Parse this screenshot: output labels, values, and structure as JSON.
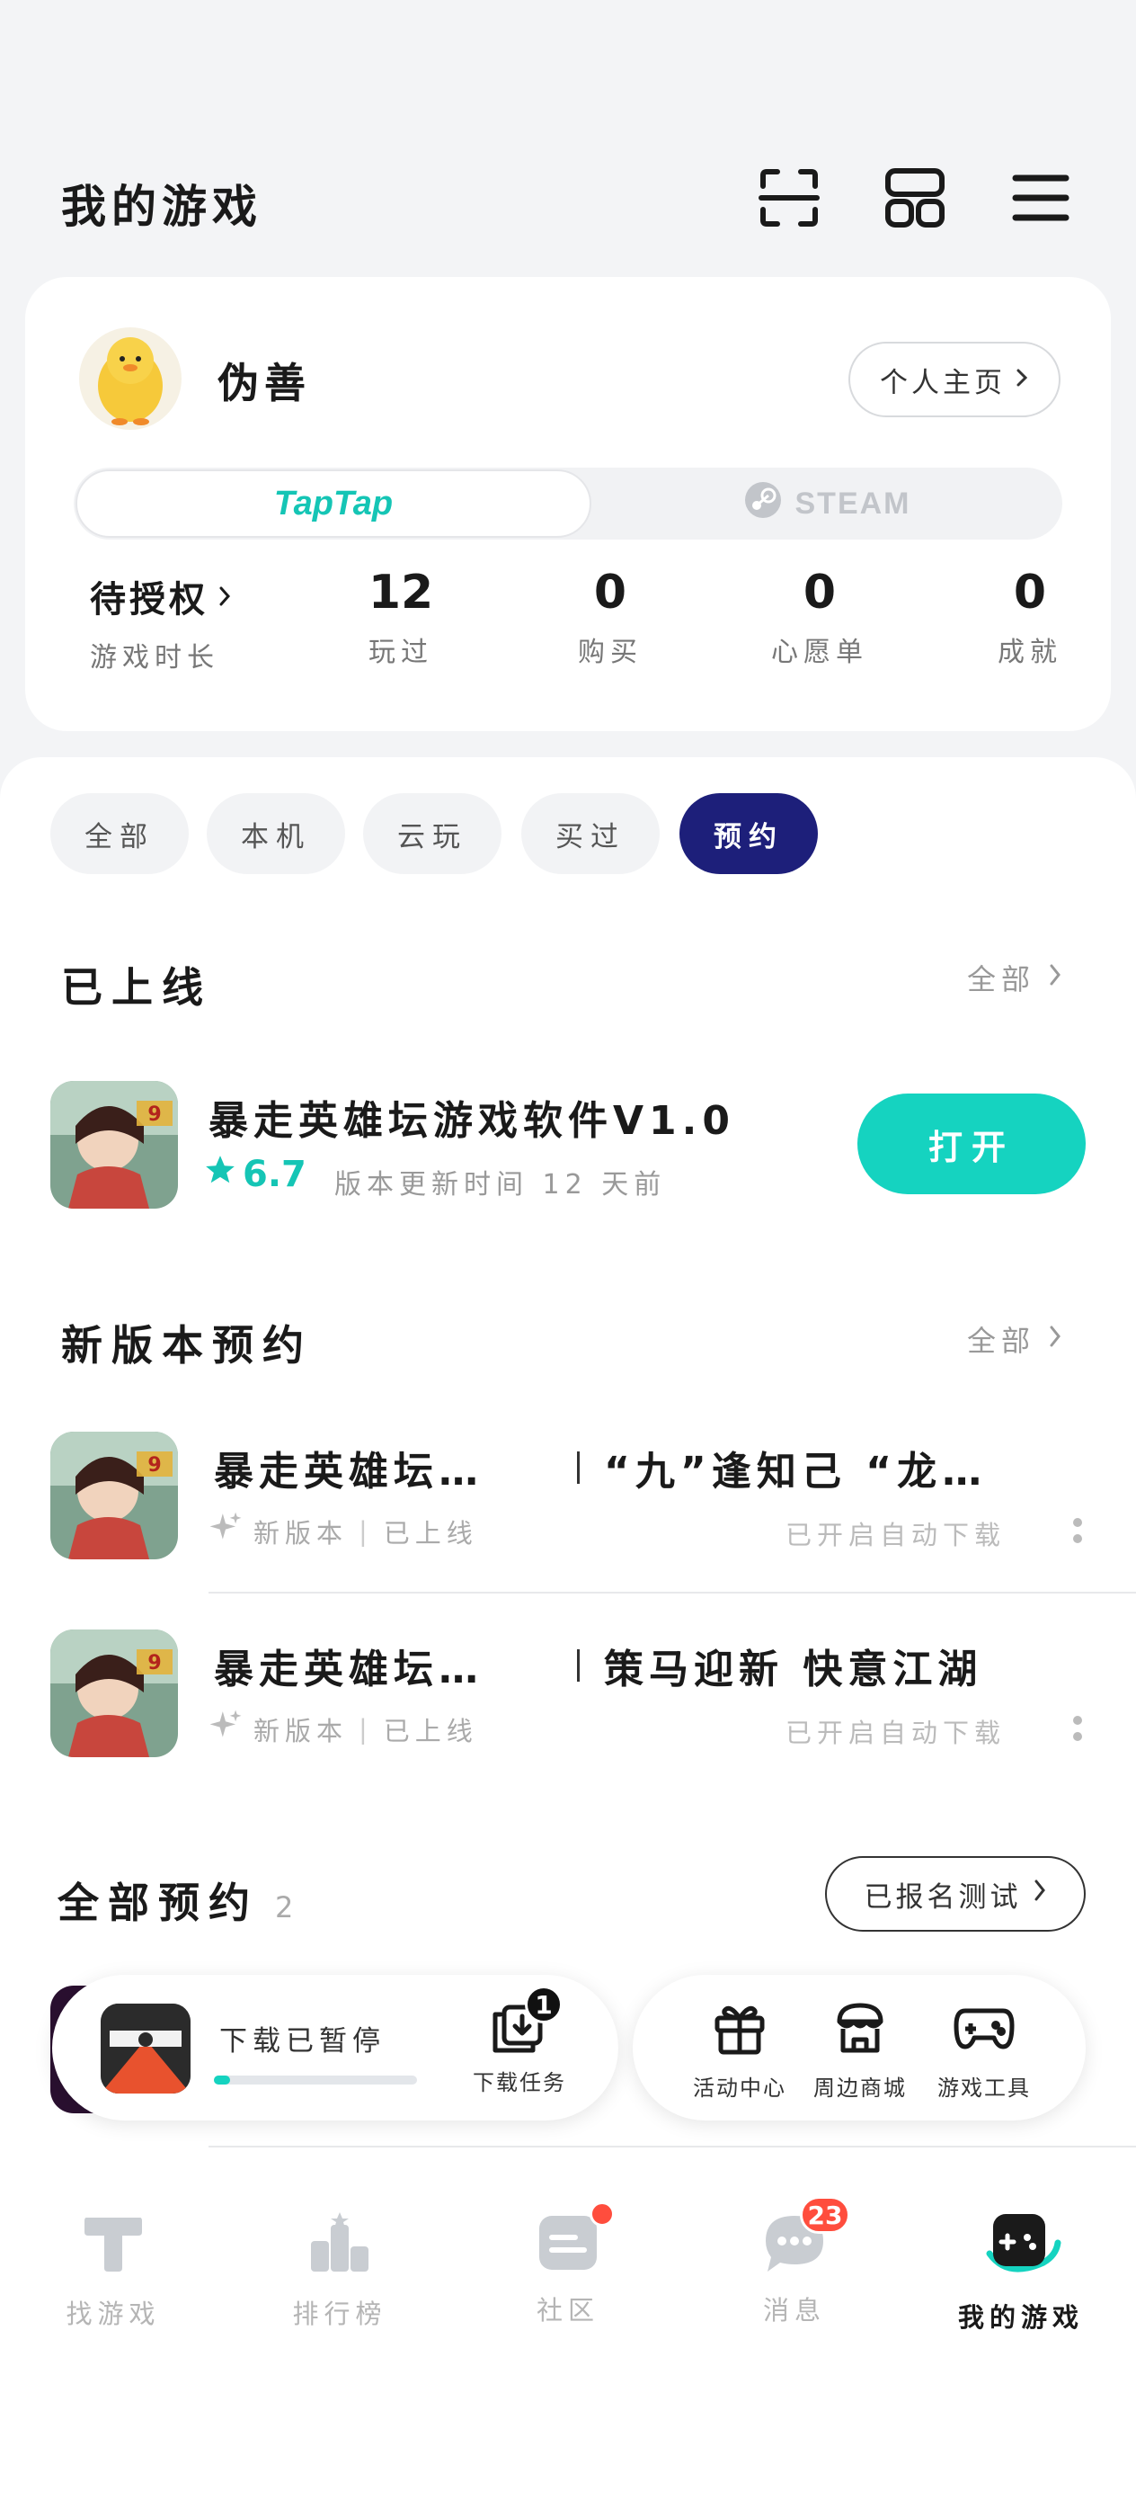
{
  "header": {
    "title": "我的游戏"
  },
  "profile": {
    "username": "伪善",
    "homepage_label": "个人主页",
    "platform_tabs": [
      {
        "label": "TapTap",
        "active": true
      },
      {
        "label": "STEAM",
        "active": false
      }
    ],
    "pending_label": "待授权",
    "pending_sub": "游戏时长",
    "stats": [
      {
        "value": "12",
        "label": "玩过"
      },
      {
        "value": "0",
        "label": "购买"
      },
      {
        "value": "0",
        "label": "心愿单"
      },
      {
        "value": "0",
        "label": "成就"
      }
    ]
  },
  "filters": [
    {
      "label": "全部",
      "active": false
    },
    {
      "label": "本机",
      "active": false
    },
    {
      "label": "云玩",
      "active": false
    },
    {
      "label": "买过",
      "active": false
    },
    {
      "label": "预约",
      "active": true
    }
  ],
  "online_section": {
    "title": "已上线",
    "more_label": "全部",
    "game": {
      "name": "暴走英雄坛游戏软件V1.0",
      "rating": "6.7",
      "update_note": "版本更新时间 12 天前",
      "action_label": "打开"
    }
  },
  "new_version_section": {
    "title": "新版本预约",
    "more_label": "全部",
    "rows": [
      {
        "game_name": "暴走英雄坛…",
        "headline": "“九”逢知己 “龙…",
        "tag": "新版本",
        "status": "已上线",
        "auto_note": "已开启自动下载"
      },
      {
        "game_name": "暴走英雄坛…",
        "headline": "策马迎新 快意江湖",
        "tag": "新版本",
        "status": "已上线",
        "auto_note": "已开启自动下载"
      }
    ]
  },
  "all_reservations": {
    "title": "全部预约",
    "count": "2",
    "signup_label": "已报名测试"
  },
  "download_panel": {
    "status": "下载已暂停",
    "progress": 0.08,
    "task_label": "下载任务",
    "task_count": "1"
  },
  "tools": [
    {
      "label": "活动中心",
      "icon": "gift-icon"
    },
    {
      "label": "周边商城",
      "icon": "shop-icon"
    },
    {
      "label": "游戏工具",
      "icon": "gamepad-icon"
    }
  ],
  "bottom_nav": [
    {
      "label": "找游戏",
      "active": false
    },
    {
      "label": "排行榜",
      "active": false
    },
    {
      "label": "社区",
      "active": false
    },
    {
      "label": "消息",
      "active": false,
      "badge": "23"
    },
    {
      "label": "我的游戏",
      "active": true
    }
  ],
  "colors": {
    "accent": "#15d3c0",
    "taptap": "#15c5b5",
    "active_chip": "#1d1f7a",
    "badge": "#ff4d3d"
  }
}
